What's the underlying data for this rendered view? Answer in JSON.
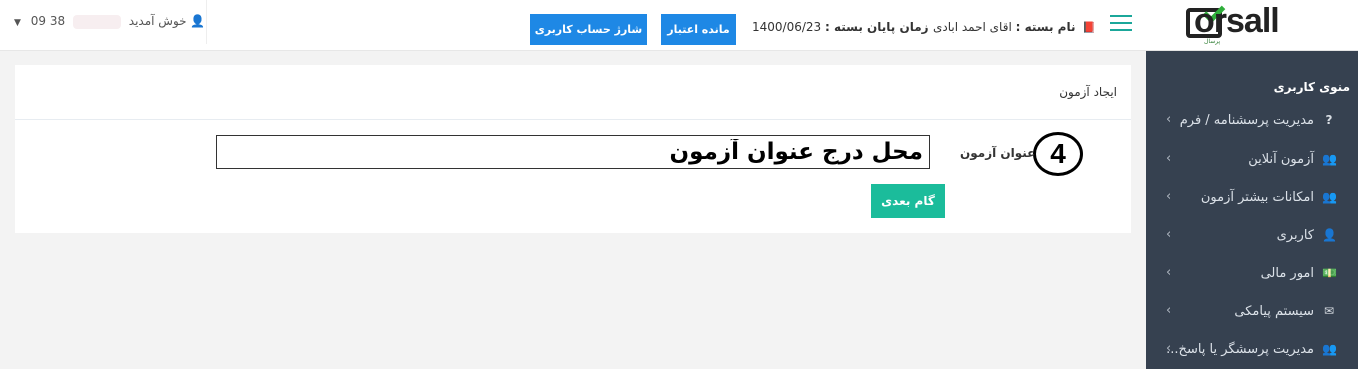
{
  "logo": {
    "brand": "orsall",
    "subtitle": "پرسال"
  },
  "topbar": {
    "package_label": "نام بسته :",
    "package_value": "اقای احمد ابادی",
    "end_date_label": "زمان پایان بسته :",
    "end_date_value": "1400/06/23",
    "balance_button": "مانده اعتبار",
    "charge_button": "شارژ حساب کاربری",
    "user_count": "38",
    "welcome": "09 خوش آمدید"
  },
  "sidebar": {
    "header": "منوی کاربری",
    "items": [
      {
        "label": "مدیریت پرسشنامه / فرم",
        "icon": "question-icon",
        "glyph": "?"
      },
      {
        "label": "آزمون آنلاین",
        "icon": "users-icon",
        "glyph": "👥"
      },
      {
        "label": "امکانات بیشتر آزمون",
        "icon": "users-icon",
        "glyph": "👥"
      },
      {
        "label": "کاربری",
        "icon": "user-icon",
        "glyph": "👤"
      },
      {
        "label": "امور مالی",
        "icon": "money-icon",
        "glyph": "💵"
      },
      {
        "label": "سیستم پیامکی",
        "icon": "envelope-icon",
        "glyph": "✉"
      },
      {
        "label": "مدیریت پرسشگر یا پاسخ...",
        "icon": "users-icon",
        "glyph": "👥"
      }
    ]
  },
  "panel": {
    "title": "ایجاد آزمون",
    "field_label": "عنوان آزمون",
    "step_number": "4",
    "input_value": "محل درج عنوان آزمون",
    "next_button": "گام بعدی"
  },
  "colors": {
    "sidebar_bg": "#364150",
    "primary_button": "#1e88e5",
    "success_button": "#1bbc9b",
    "hamburger": "#1ba79a"
  }
}
